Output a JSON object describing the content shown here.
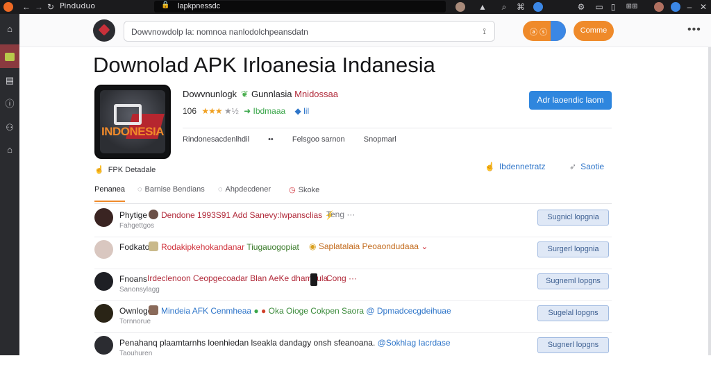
{
  "browser": {
    "tab_title": "Pinduduo",
    "url": "lapkpnessdc",
    "back_icon": "arrow-left-icon",
    "reload_icon": "reload-icon"
  },
  "rail": {
    "items": [
      "home-icon",
      "app-icon",
      "document-icon",
      "info-icon",
      "users-icon",
      "store-icon"
    ]
  },
  "header": {
    "search_placeholder": "Dowvnowdolp la: nomnoa nanlodolchpeansdatn",
    "pill_label": "ⓐ ⓢ",
    "pill_suffix": "C",
    "action_button": "Comme",
    "more": "•••"
  },
  "main": {
    "title": "Downolad APK Irloanesia Indanesia",
    "app_icon_text": "INDONESIA",
    "developer": "Dowvnunlogk",
    "category_prefix": "Gunnlasia",
    "category": "Mnidossaa",
    "rating_count": "106",
    "stars": "★★★",
    "stars_gray": "★½",
    "rating_extra": "➜ Ibdmaaa",
    "rating_suffix": "◆ lil",
    "meta": [
      "Rindonesacdenlhdil",
      "Felsgoo sarnon",
      "Snopmarl"
    ],
    "meta_dots": "••",
    "install_button": "Adr laoendic laom",
    "apk_label": "FPK Detadale",
    "share1": "Ibdennetratz",
    "share2": "Saotie",
    "tabs": [
      "Penanea",
      "Barnise Bendians",
      "Ahpdecdener",
      "Skoke"
    ]
  },
  "list": [
    {
      "name": "Phytige",
      "sub": "Fahgettgos",
      "text": "Dendone 1993S91 Add Sanevy:lwpansclias",
      "text_color": "#b12a3a",
      "extra": "Teng ···",
      "button": "Sugnicl lopgnia"
    },
    {
      "name": "Fodkato",
      "sub": "",
      "text": "Rodakipkehokandanar",
      "text_color": "#d0303a",
      "text2": "Tiugauogopiat",
      "text2_color": "#3a7a2a",
      "text3": "Saplatalaia Peoaondudaaa",
      "text3_color": "#c2691a",
      "button": "Surgerl lopgnia"
    },
    {
      "name": "Fnoans",
      "sub": "Sanonsylagg",
      "text": "Irdeclenoon Ceopgecoadar Blan AeKe dhampula",
      "text_color": "#b12a3a",
      "extra": "Cong ···",
      "button": "Sugneml lopgns"
    },
    {
      "name": "Ownloge",
      "sub": "Tornnorue",
      "text": "Mindeia AFK Cenmheaa",
      "text_color": "#2e75c9",
      "text2": "Oka Oioge Cokpen Saora",
      "text2_color": "#3a8a3a",
      "text3": "@ Dpmadcecgdeihuae",
      "text3_color": "#2e75c9",
      "button": "Sugelal lopgns"
    },
    {
      "name": "Penahanq plaamtarnhs loenhiedan lseakla dandagy onsh sfeanoana.",
      "sub": "Taouhuren",
      "text": "@Sokhlag Iacrdase",
      "text_color": "#2e75c9",
      "button": "Sugnerl lopgns"
    }
  ],
  "colors": {
    "accent_orange": "#ef8a2a",
    "accent_blue": "#2e86de",
    "rail_bg": "#2a2b2f",
    "chrome_bg": "#1b1b1d"
  }
}
